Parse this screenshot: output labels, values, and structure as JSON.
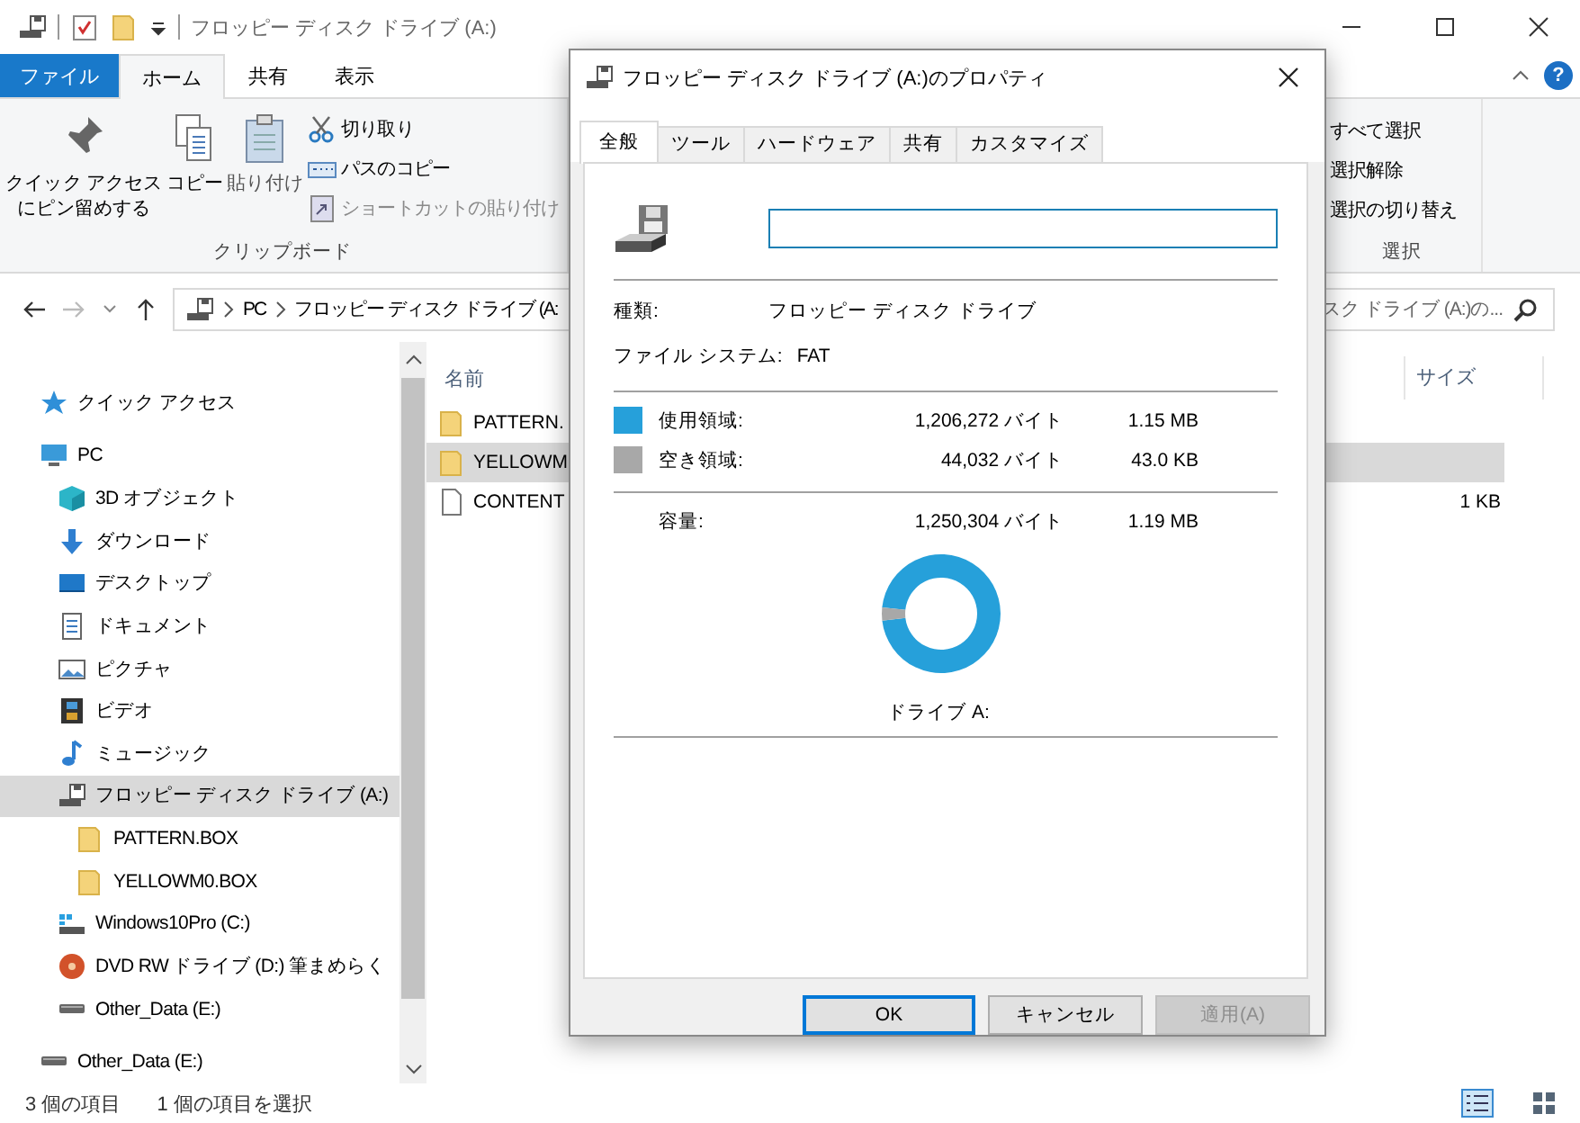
{
  "window": {
    "title": "フロッピー ディスク ドライブ (A:)"
  },
  "ribbon_tabs": [
    {
      "label": "ファイル",
      "kind": "file",
      "selected": false
    },
    {
      "label": "ホーム",
      "kind": "tab",
      "selected": true
    },
    {
      "label": "共有",
      "kind": "tab",
      "selected": false
    },
    {
      "label": "表示",
      "kind": "tab",
      "selected": false
    }
  ],
  "help_button": "?",
  "ribbon": {
    "pin_button": [
      "クイック アクセス",
      "にピン留めする"
    ],
    "copy_button": "コピー",
    "paste_button": "貼り付け",
    "small_buttons": [
      {
        "label": "切り取り",
        "disabled": false
      },
      {
        "label": "パスのコピー",
        "disabled": false
      },
      {
        "label": "ショートカットの貼り付け",
        "disabled": true
      }
    ],
    "clipboard_group": "クリップボード",
    "select_buttons": [
      "すべて選択",
      "選択解除",
      "選択の切り替え"
    ],
    "select_group": "選択"
  },
  "address_bar": {
    "parts": [
      "PC",
      "フロッピー ディスク ドライブ (A:"
    ]
  },
  "search": {
    "value": "スク ドライブ (A:)の..."
  },
  "nav_pane": {
    "items": [
      {
        "label": "クイック アクセス",
        "kind": "star",
        "selected": false
      },
      {
        "label": "PC",
        "kind": "computer",
        "selected": false,
        "children": [
          {
            "label": "3D オブジェクト",
            "kind": "cube",
            "selected": false
          },
          {
            "label": "ダウンロード",
            "kind": "download",
            "selected": false
          },
          {
            "label": "デスクトップ",
            "kind": "desktop",
            "selected": false
          },
          {
            "label": "ドキュメント",
            "kind": "document",
            "selected": false
          },
          {
            "label": "ピクチャ",
            "kind": "image",
            "selected": false
          },
          {
            "label": "ビデオ",
            "kind": "film",
            "selected": false
          },
          {
            "label": "ミュージック",
            "kind": "music",
            "selected": false
          },
          {
            "label": "フロッピー ディスク ドライブ (A:)",
            "kind": "floppy",
            "selected": true,
            "children": [
              {
                "label": "PATTERN.BOX",
                "kind": "folder",
                "selected": false
              },
              {
                "label": "YELLOWM0.BOX",
                "kind": "folder",
                "selected": false
              }
            ]
          },
          {
            "label": "Windows10Pro (C:)",
            "kind": "windrive",
            "selected": false
          },
          {
            "label": "DVD RW ドライブ (D:) 筆まめらく",
            "kind": "disc",
            "selected": false
          },
          {
            "label": "Other_Data (E:)",
            "kind": "drive",
            "selected": false
          }
        ]
      },
      {
        "label": "Other_Data (E:)",
        "kind": "drive",
        "selected": false
      }
    ]
  },
  "file_list": {
    "columns": [
      "名前",
      "サイズ"
    ],
    "rows": [
      {
        "name": "PATTERN.",
        "kind": "folder",
        "size": "",
        "selected": false
      },
      {
        "name": "YELLOWM",
        "kind": "folder",
        "size": "",
        "selected": true
      },
      {
        "name": "CONTENT",
        "kind": "file",
        "size": "1 KB",
        "selected": false
      }
    ]
  },
  "status_bar": {
    "count": "3 個の項目",
    "selection": "1 個の項目を選択"
  },
  "dialog": {
    "title": "フロッピー ディスク ドライブ (A:)のプロパティ",
    "tabs": [
      {
        "label": "全般",
        "selected": true
      },
      {
        "label": "ツール",
        "selected": false
      },
      {
        "label": "ハードウェア",
        "selected": false
      },
      {
        "label": "共有",
        "selected": false
      },
      {
        "label": "カスタマイズ",
        "selected": false
      }
    ],
    "info": [
      {
        "label": "種類:",
        "value": "フロッピー ディスク ドライブ"
      },
      {
        "label": "ファイル システム:",
        "value": "FAT"
      }
    ],
    "usage": [
      {
        "label": "使用領域:",
        "bytes": "1,206,272 バイト",
        "size": "1.15 MB",
        "color": "#26a0da"
      },
      {
        "label": "空き領域:",
        "bytes": "44,032 バイト",
        "size": "43.0 KB",
        "color": "#a8a8a8"
      }
    ],
    "capacity": {
      "label": "容量:",
      "bytes": "1,250,304 バイト",
      "size": "1.19 MB"
    },
    "chart_data": {
      "type": "donut",
      "values": [
        96.48,
        3.52
      ]
    },
    "drive_label": "ドライブ A:",
    "buttons": [
      {
        "label": "OK",
        "kind": "default",
        "disabled": false
      },
      {
        "label": "キャンセル",
        "kind": "normal",
        "disabled": false
      },
      {
        "label": "適用(A)",
        "kind": "normal",
        "disabled": true
      }
    ]
  }
}
